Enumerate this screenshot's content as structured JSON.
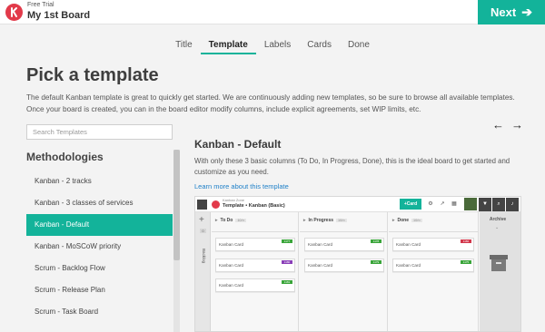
{
  "header": {
    "trial": "Free Trial",
    "board_name": "My 1st Board",
    "next_label": "Next",
    "next_icon": "arrow-right-icon",
    "logo_icon": "kanbanize-logo"
  },
  "steps": [
    {
      "label": "Title",
      "active": false
    },
    {
      "label": "Template",
      "active": true
    },
    {
      "label": "Labels",
      "active": false
    },
    {
      "label": "Cards",
      "active": false
    },
    {
      "label": "Done",
      "active": false
    }
  ],
  "main": {
    "title": "Pick a template",
    "intro": "The default Kanban template is great to quickly get started. We are continuously adding new templates, so be sure to browse all available templates. Once your board is created, you can in the board editor modify columns, include explicit agreements, set WIP limits, etc."
  },
  "nav": {
    "prev": "←",
    "next": "→"
  },
  "search": {
    "placeholder": "Search Templates",
    "value": ""
  },
  "sidebar": {
    "title": "Methodologies",
    "items": [
      {
        "label": "Kanban - 2 tracks",
        "active": false
      },
      {
        "label": "Kanban - 3 classes of services",
        "active": false
      },
      {
        "label": "Kanban - Default",
        "active": true
      },
      {
        "label": "Kanban - MoSCoW priority",
        "active": false
      },
      {
        "label": "Scrum - Backlog Flow",
        "active": false
      },
      {
        "label": "Scrum - Release Plan",
        "active": false
      },
      {
        "label": "Scrum - Task Board",
        "active": false
      }
    ]
  },
  "detail": {
    "title": "Kanban - Default",
    "description": "With only these 3 basic columns (To Do, In Progress, Done), this is the ideal board to get started and customize as you need.",
    "link": "Learn more about this template"
  },
  "preview": {
    "zone": "Kanban Zone",
    "board_name": "Template • Kanban (Basic)",
    "add_card": "+Card",
    "left_count": "0",
    "backlog": "Backlog",
    "columns": [
      {
        "name": "To Do",
        "wip": "10/∞"
      },
      {
        "name": "In Progress",
        "wip": "10/∞"
      },
      {
        "name": "Done",
        "wip": "10/∞"
      }
    ],
    "card_label": "Kanban Card",
    "cards": [
      {
        "col": 0,
        "row": 0,
        "tag": "1177",
        "tag_color": "#3aa53a"
      },
      {
        "col": 0,
        "row": 1,
        "tag": "1180",
        "tag_color": "#8a3fb8"
      },
      {
        "col": 0,
        "row": 2,
        "tag": "1181",
        "tag_color": "#3aa53a"
      },
      {
        "col": 1,
        "row": 0,
        "tag": "1178",
        "tag_color": "#3aa53a"
      },
      {
        "col": 1,
        "row": 1,
        "tag": "1179",
        "tag_color": "#3aa53a"
      },
      {
        "col": 2,
        "row": 0,
        "tag": "1182",
        "tag_color": "#d2374b"
      },
      {
        "col": 2,
        "row": 1,
        "tag": "1175",
        "tag_color": "#3aa53a"
      }
    ],
    "archive": "Archive"
  },
  "colors": {
    "accent": "#13b39a",
    "brand": "#e23a4a",
    "link": "#1f80c8"
  }
}
